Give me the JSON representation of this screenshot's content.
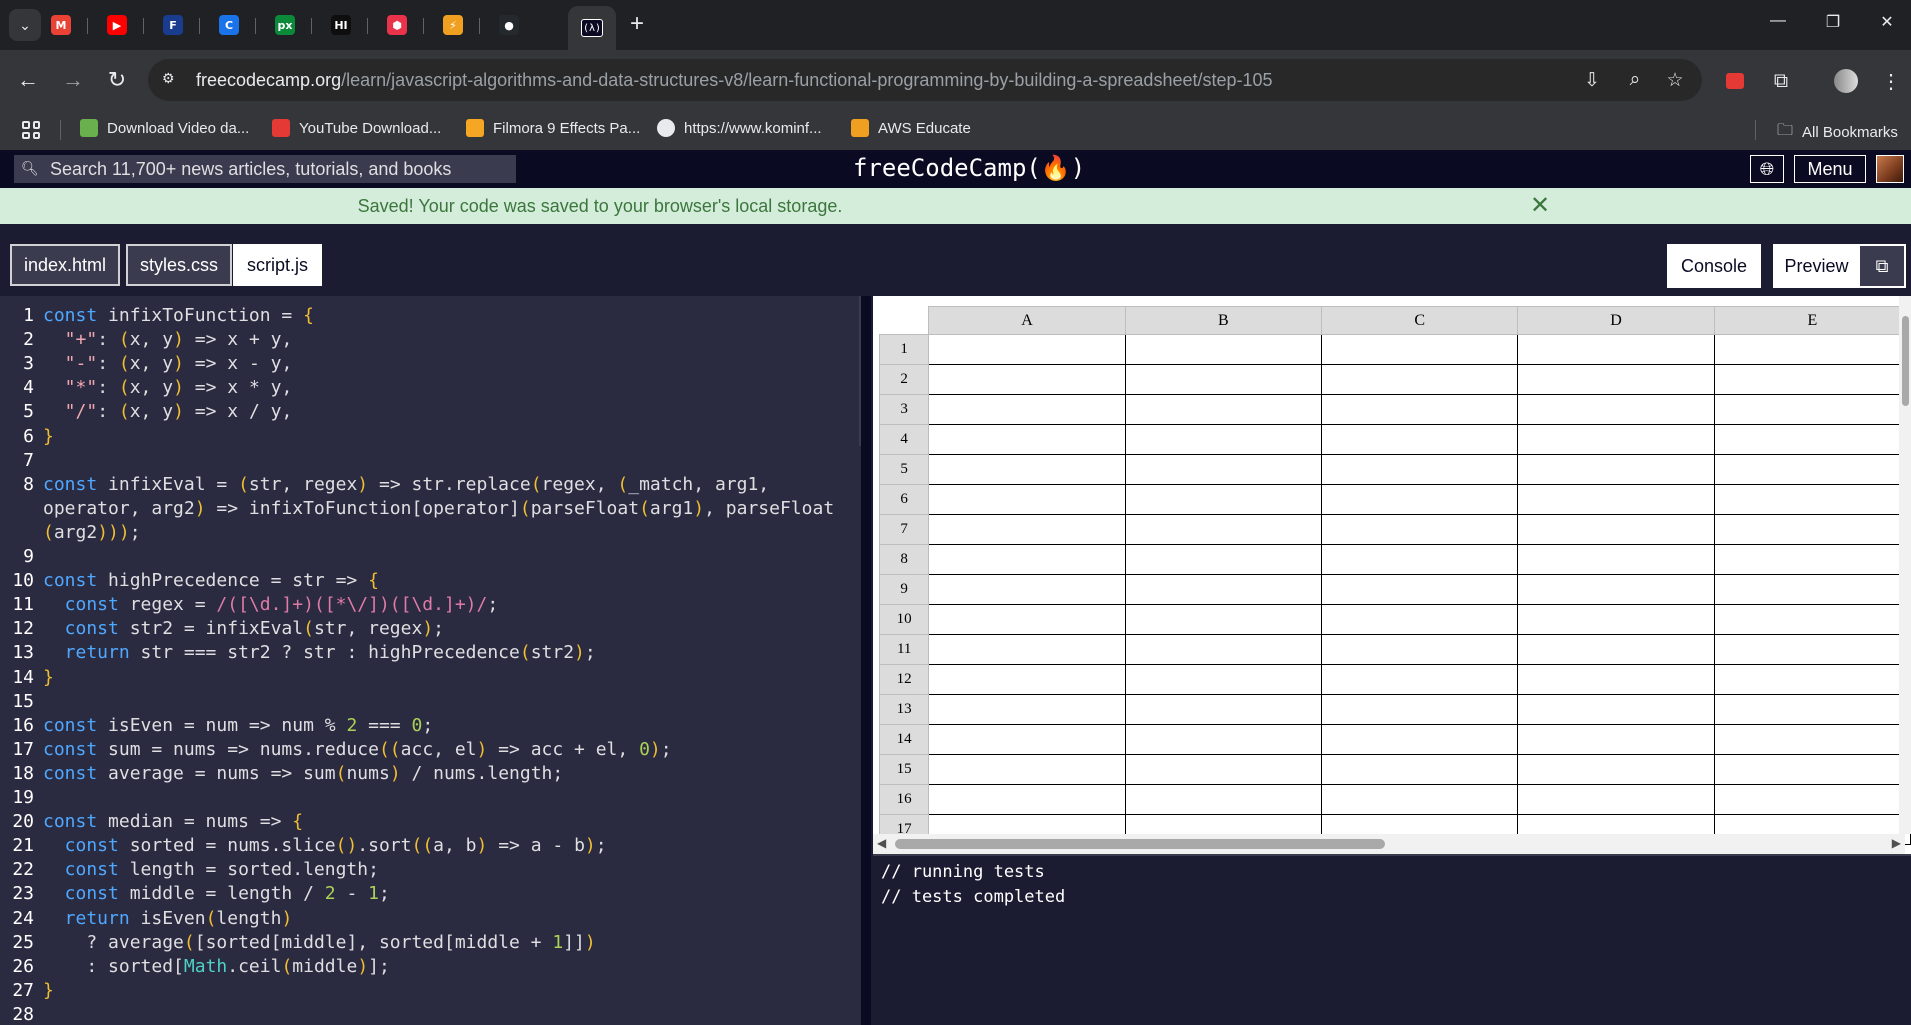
{
  "browser": {
    "tab_search_icon": "chevron-down-icon",
    "pinned_tabs": [
      {
        "icon": "gmail-icon",
        "glyph": "M",
        "color": "#ea4335"
      },
      {
        "icon": "youtube-icon",
        "glyph": "▶",
        "color": "#ff0000"
      },
      {
        "icon": "f-brand-icon",
        "glyph": "F",
        "color": "#1a3c8f"
      },
      {
        "icon": "c-brand-icon",
        "glyph": "C",
        "color": "#1a73e8"
      },
      {
        "icon": "px-icon",
        "glyph": "px",
        "color": "#0b8a3a"
      },
      {
        "icon": "hi-icon",
        "glyph": "HI",
        "color": "#0e0e0e"
      },
      {
        "icon": "hexagon-icon",
        "glyph": "⬢",
        "color": "#e8334a"
      },
      {
        "icon": "bolt-icon",
        "glyph": "⚡",
        "color": "#f0a020"
      },
      {
        "icon": "github-icon",
        "glyph": "●",
        "color": "#24292e"
      }
    ],
    "active_tab_glyph": "(λ)",
    "new_tab": "+",
    "window_controls": [
      "—",
      "❐",
      "✕"
    ],
    "url_host": "freecodecamp.org",
    "url_path": "/learn/javascript-algorithms-and-data-structures-v8/learn-functional-programming-by-building-a-spreadsheet/step-105",
    "bookmarks": [
      {
        "label": "Download Video da...",
        "color": "#6ab04c"
      },
      {
        "label": "YouTube Download...",
        "color": "#e53935"
      },
      {
        "label": "Filmora 9 Effects Pa...",
        "color": "#f5a623"
      },
      {
        "label": "https://www.kominf...",
        "color": "#e8eaed"
      },
      {
        "label": "AWS Educate",
        "color": "#f0a020"
      }
    ],
    "all_bookmarks": "All Bookmarks"
  },
  "fcc": {
    "search_placeholder": "Search 11,700+ news articles, tutorials, and books",
    "logo": "freeCodeCamp(🔥)",
    "menu": "Menu",
    "flash_message": "Saved! Your code was saved to your browser's local storage.",
    "file_tabs": [
      "index.html",
      "styles.css",
      "script.js"
    ],
    "console_button": "Console",
    "preview_button": "Preview"
  },
  "editor": {
    "lines": [
      {
        "n": "1",
        "t": [
          [
            "kw",
            "const"
          ],
          [
            "op",
            " infixToFunction = "
          ],
          [
            "br",
            "{"
          ]
        ]
      },
      {
        "n": "2",
        "t": [
          [
            "str",
            "  \"+\""
          ],
          [
            "op",
            ": "
          ],
          [
            "br",
            "("
          ],
          [
            "op",
            "x, y"
          ],
          [
            "br",
            ")"
          ],
          [
            "op",
            " => x + y,"
          ]
        ]
      },
      {
        "n": "3",
        "t": [
          [
            "str",
            "  \"-\""
          ],
          [
            "op",
            ": "
          ],
          [
            "br",
            "("
          ],
          [
            "op",
            "x, y"
          ],
          [
            "br",
            ")"
          ],
          [
            "op",
            " => x - y,"
          ]
        ]
      },
      {
        "n": "4",
        "t": [
          [
            "str",
            "  \"*\""
          ],
          [
            "op",
            ": "
          ],
          [
            "br",
            "("
          ],
          [
            "op",
            "x, y"
          ],
          [
            "br",
            ")"
          ],
          [
            "op",
            " => x * y,"
          ]
        ]
      },
      {
        "n": "5",
        "t": [
          [
            "str",
            "  \"/\""
          ],
          [
            "op",
            ": "
          ],
          [
            "br",
            "("
          ],
          [
            "op",
            "x, y"
          ],
          [
            "br",
            ")"
          ],
          [
            "op",
            " => x / y,"
          ]
        ]
      },
      {
        "n": "6",
        "t": [
          [
            "br",
            "}"
          ]
        ]
      },
      {
        "n": "7",
        "t": []
      },
      {
        "n": "8",
        "t": [
          [
            "kw",
            "const"
          ],
          [
            "op",
            " infixEval = "
          ],
          [
            "br",
            "("
          ],
          [
            "op",
            "str, regex"
          ],
          [
            "br",
            ")"
          ],
          [
            "op",
            " => str.replace"
          ],
          [
            "br",
            "("
          ],
          [
            "op",
            "regex, "
          ],
          [
            "br",
            "("
          ],
          [
            "op",
            "_match, arg1,"
          ]
        ]
      },
      {
        "n": "",
        "t": [
          [
            "op",
            "operator, arg2"
          ],
          [
            "br",
            ")"
          ],
          [
            "op",
            " => infixToFunction[operator]"
          ],
          [
            "br",
            "("
          ],
          [
            "op",
            "parseFloat"
          ],
          [
            "br",
            "("
          ],
          [
            "op",
            "arg1"
          ],
          [
            "br",
            ")"
          ],
          [
            "op",
            ", parseFloat"
          ]
        ]
      },
      {
        "n": "",
        "t": [
          [
            "br",
            "("
          ],
          [
            "op",
            "arg2"
          ],
          [
            "br",
            ")))"
          ],
          [
            "op",
            ";"
          ]
        ]
      },
      {
        "n": "9",
        "t": []
      },
      {
        "n": "10",
        "t": [
          [
            "kw",
            "const"
          ],
          [
            "op",
            " highPrecedence = str => "
          ],
          [
            "br",
            "{"
          ]
        ]
      },
      {
        "n": "11",
        "t": [
          [
            "kw",
            "  const"
          ],
          [
            "op",
            " regex = "
          ],
          [
            "re",
            "/([\\d.]+)([*\\/])([\\d.]+)/"
          ],
          [
            "op",
            ";"
          ]
        ]
      },
      {
        "n": "12",
        "t": [
          [
            "kw",
            "  const"
          ],
          [
            "op",
            " str2 = infixEval"
          ],
          [
            "br",
            "("
          ],
          [
            "op",
            "str, regex"
          ],
          [
            "br",
            ")"
          ],
          [
            "op",
            ";"
          ]
        ]
      },
      {
        "n": "13",
        "t": [
          [
            "kw",
            "  return"
          ],
          [
            "op",
            " str === str2 ? str : highPrecedence"
          ],
          [
            "br",
            "("
          ],
          [
            "op",
            "str2"
          ],
          [
            "br",
            ")"
          ],
          [
            "op",
            ";"
          ]
        ]
      },
      {
        "n": "14",
        "t": [
          [
            "br",
            "}"
          ]
        ]
      },
      {
        "n": "15",
        "t": []
      },
      {
        "n": "16",
        "t": [
          [
            "kw",
            "const"
          ],
          [
            "op",
            " isEven = num => num % "
          ],
          [
            "nm",
            "2"
          ],
          [
            "op",
            " === "
          ],
          [
            "nm",
            "0"
          ],
          [
            "op",
            ";"
          ]
        ]
      },
      {
        "n": "17",
        "t": [
          [
            "kw",
            "const"
          ],
          [
            "op",
            " sum = nums => nums.reduce"
          ],
          [
            "br",
            "(("
          ],
          [
            "op",
            "acc, el"
          ],
          [
            "br",
            ")"
          ],
          [
            "op",
            " => acc + el, "
          ],
          [
            "nm",
            "0"
          ],
          [
            "br",
            ")"
          ],
          [
            "op",
            ";"
          ]
        ]
      },
      {
        "n": "18",
        "t": [
          [
            "kw",
            "const"
          ],
          [
            "op",
            " average = nums => sum"
          ],
          [
            "br",
            "("
          ],
          [
            "op",
            "nums"
          ],
          [
            "br",
            ")"
          ],
          [
            "op",
            " / nums.length;"
          ]
        ]
      },
      {
        "n": "19",
        "t": []
      },
      {
        "n": "20",
        "t": [
          [
            "kw",
            "const"
          ],
          [
            "op",
            " median = nums => "
          ],
          [
            "br",
            "{"
          ]
        ]
      },
      {
        "n": "21",
        "t": [
          [
            "kw",
            "  const"
          ],
          [
            "op",
            " sorted = nums.slice"
          ],
          [
            "br",
            "()"
          ],
          [
            "op",
            ".sort"
          ],
          [
            "br",
            "(("
          ],
          [
            "op",
            "a, b"
          ],
          [
            "br",
            ")"
          ],
          [
            "op",
            " => a - b"
          ],
          [
            "br",
            ")"
          ],
          [
            "op",
            ";"
          ]
        ]
      },
      {
        "n": "22",
        "t": [
          [
            "kw",
            "  const"
          ],
          [
            "op",
            " length = sorted.length;"
          ]
        ]
      },
      {
        "n": "23",
        "t": [
          [
            "kw",
            "  const"
          ],
          [
            "op",
            " middle = length / "
          ],
          [
            "nm",
            "2"
          ],
          [
            "op",
            " - "
          ],
          [
            "nm",
            "1"
          ],
          [
            "op",
            ";"
          ]
        ]
      },
      {
        "n": "24",
        "t": [
          [
            "kw",
            "  return"
          ],
          [
            "op",
            " isEven"
          ],
          [
            "br",
            "("
          ],
          [
            "op",
            "length"
          ],
          [
            "br",
            ")"
          ]
        ]
      },
      {
        "n": "25",
        "t": [
          [
            "op",
            "    ? average"
          ],
          [
            "br",
            "("
          ],
          [
            "op",
            "[sorted[middle], sorted[middle + "
          ],
          [
            "nm",
            "1"
          ],
          [
            "op",
            "]]"
          ],
          [
            "br",
            ")"
          ]
        ]
      },
      {
        "n": "26",
        "t": [
          [
            "op",
            "    : sorted["
          ],
          [
            "bi",
            "Math"
          ],
          [
            "op",
            ".ceil"
          ],
          [
            "br",
            "("
          ],
          [
            "op",
            "middle"
          ],
          [
            "br",
            ")"
          ],
          [
            "op",
            "];"
          ]
        ]
      },
      {
        "n": "27",
        "t": [
          [
            "br",
            "}"
          ]
        ]
      },
      {
        "n": "28",
        "t": []
      }
    ]
  },
  "spreadsheet": {
    "columns": [
      "A",
      "B",
      "C",
      "D",
      "E"
    ],
    "rows": [
      "1",
      "2",
      "3",
      "4",
      "5",
      "6",
      "7",
      "8",
      "9",
      "10",
      "11",
      "12",
      "13",
      "14",
      "15",
      "16",
      "17"
    ]
  },
  "console": {
    "lines": [
      "// running tests",
      "// tests completed"
    ]
  }
}
